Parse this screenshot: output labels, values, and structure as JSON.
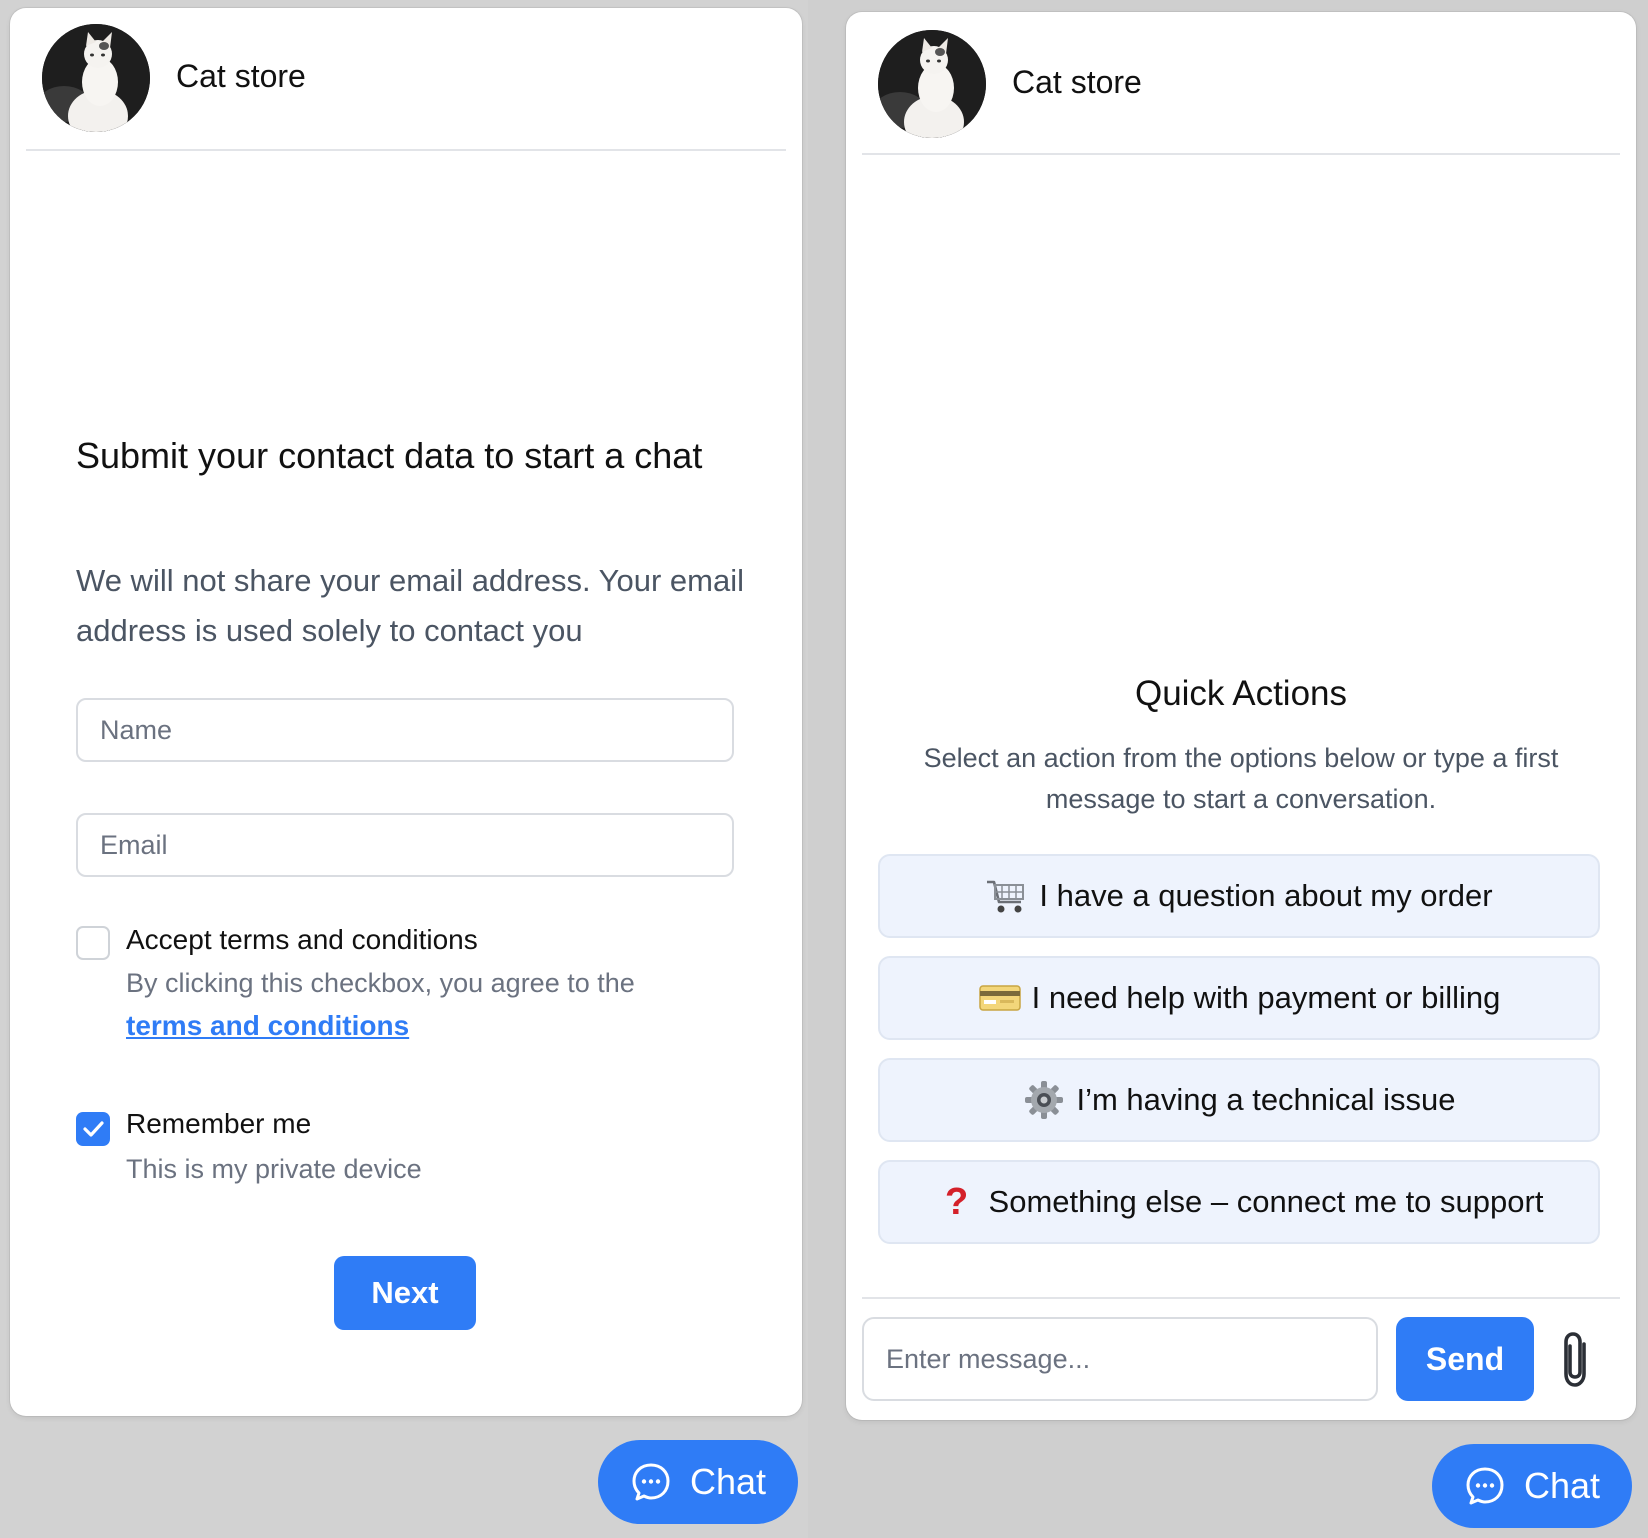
{
  "left_panel": {
    "store_name": "Cat store",
    "form_title": "Submit your contact data to start a chat",
    "form_description": "We will not share your email address. Your email address is used solely to contact you",
    "name_placeholder": "Name",
    "email_placeholder": "Email",
    "terms": {
      "label": "Accept terms and conditions",
      "description": "By clicking this checkbox, you agree to the",
      "link_text": "terms and conditions",
      "checked": false
    },
    "remember": {
      "label": "Remember me",
      "description": "This is my private device",
      "checked": true
    },
    "next_label": "Next"
  },
  "right_panel": {
    "store_name": "Cat store",
    "quick_actions_title": "Quick Actions",
    "quick_actions_description": "Select an action from the options below or type a first message to start a conversation.",
    "actions": [
      {
        "icon": "shopping-cart-icon",
        "label": "I have a question about my order"
      },
      {
        "icon": "credit-card-icon",
        "label": "I need help with payment or billing"
      },
      {
        "icon": "gear-icon",
        "label": "I’m having a technical issue"
      },
      {
        "icon": "question-mark-icon",
        "label": "Something else – connect me to support"
      }
    ],
    "message_placeholder": "Enter message...",
    "send_label": "Send"
  },
  "chat_launcher": {
    "label": "Chat"
  },
  "colors": {
    "accent": "#2f7cf6",
    "quick_action_bg": "#eef3fd",
    "question_mark": "#d4202a"
  }
}
